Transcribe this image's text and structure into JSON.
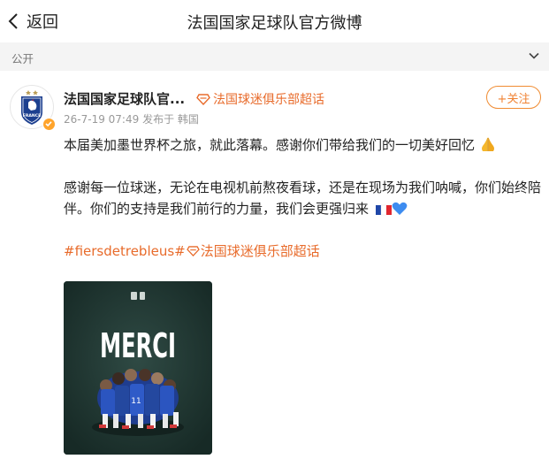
{
  "header": {
    "back_label": "返回",
    "title": "法国国家足球队官方微博"
  },
  "visibility": {
    "label": "公开"
  },
  "author": {
    "name": "法国国家足球队官...",
    "topic": "法国球迷俱乐部超话",
    "date": "26-7-19 07:49",
    "source": "发布于 韩国",
    "follow_label": "+关注",
    "avatar_text": "FRANCE"
  },
  "post": {
    "line1": "本届美加墨世界杯之旅，就此落幕。感谢你们带给我们的一切美好回忆",
    "line2a": "感谢每一位球迷，无论在电视机前熬夜看球，还是在现场为我们呐喊，你们始终陪",
    "line2b": "伴。你们的支持是我们前行的力量，我们会更强归来",
    "hashtag": "#fiersdetrebleus#",
    "hashtag_topic": "法国球迷俱乐部超话"
  },
  "image": {
    "caption": "MERCI"
  },
  "colors": {
    "accent": "#e86b2b",
    "follow": "#f08232",
    "photo_bg": "#1e3530",
    "verified": "#ffa42b"
  },
  "icons": [
    "back-chevron-icon",
    "chevron-down-icon",
    "verified-icon",
    "supertopic-diamond-icon",
    "pray-emoji-icon",
    "france-flag-emoji-icon",
    "blue-heart-emoji-icon"
  ]
}
